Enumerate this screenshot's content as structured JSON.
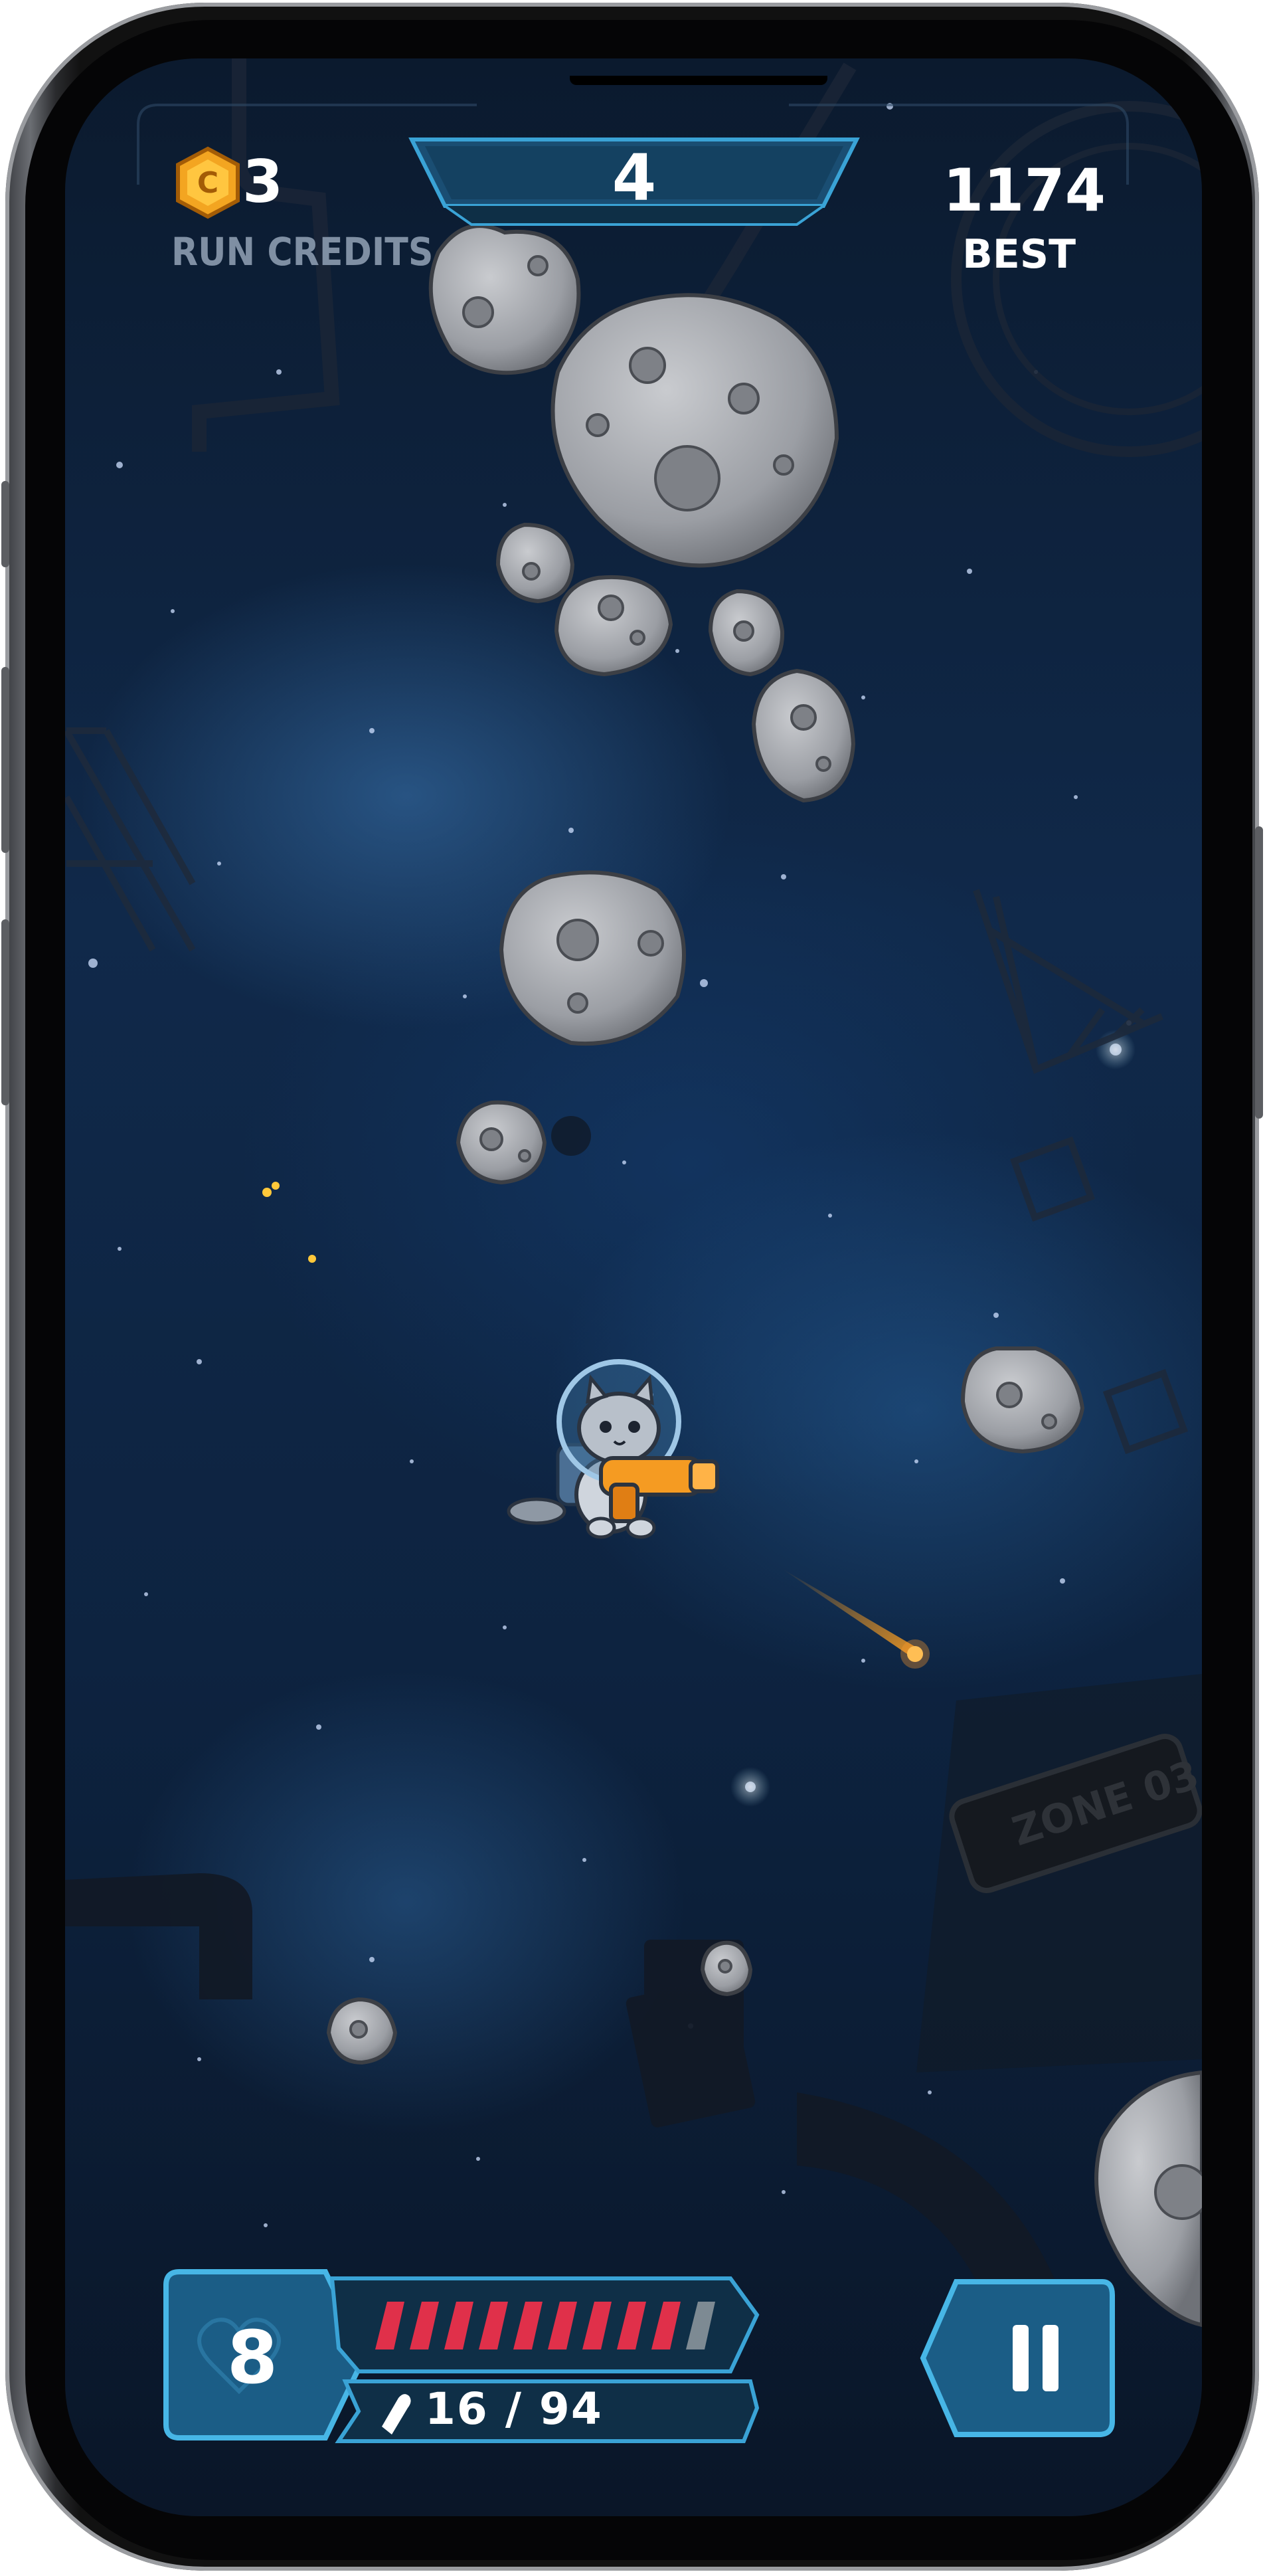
{
  "hud": {
    "run_credits_value": "3",
    "run_credits_label": "RUN CREDITS",
    "score": "4",
    "best_value": "1174",
    "best_label": "BEST",
    "lives": "8",
    "ammo": "16 / 94",
    "health_segments_filled": 9,
    "health_segments_total": 10
  },
  "world": {
    "zone_sign": "ZONE 03"
  },
  "colors": {
    "hud_blue": "#1f7ba6",
    "hud_dark": "#0e2f46",
    "health_red": "#e0304a",
    "coin_gold": "#f3a521",
    "blaster_orange": "#f59b22"
  },
  "icons": [
    "coin-icon",
    "bullet-icon",
    "pause-icon",
    "heart-icon"
  ]
}
